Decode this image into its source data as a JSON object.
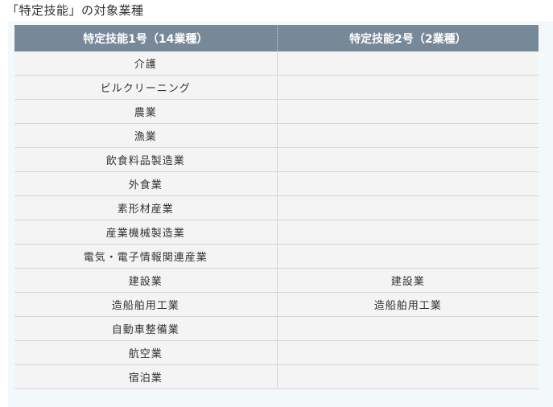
{
  "caption": "「特定技能」の対象業種",
  "table": {
    "headers": [
      "特定技能1号（14業種）",
      "特定技能2号（2業種）"
    ],
    "rows": [
      [
        "介護",
        ""
      ],
      [
        "ビルクリーニング",
        ""
      ],
      [
        "農業",
        ""
      ],
      [
        "漁業",
        ""
      ],
      [
        "飲食料品製造業",
        ""
      ],
      [
        "外食業",
        ""
      ],
      [
        "素形材産業",
        ""
      ],
      [
        "産業機械製造業",
        ""
      ],
      [
        "電気・電子情報関連産業",
        ""
      ],
      [
        "建設業",
        "建設業"
      ],
      [
        "造船舶用工業",
        "造船舶用工業"
      ],
      [
        "自動車整備業",
        ""
      ],
      [
        "航空業",
        ""
      ],
      [
        "宿泊業",
        ""
      ]
    ]
  },
  "colors": {
    "header_bg": "#778899",
    "header_text": "#ffffff",
    "cell_bg": "#f4f4f4",
    "panel_bg": "#f3f8fb"
  }
}
